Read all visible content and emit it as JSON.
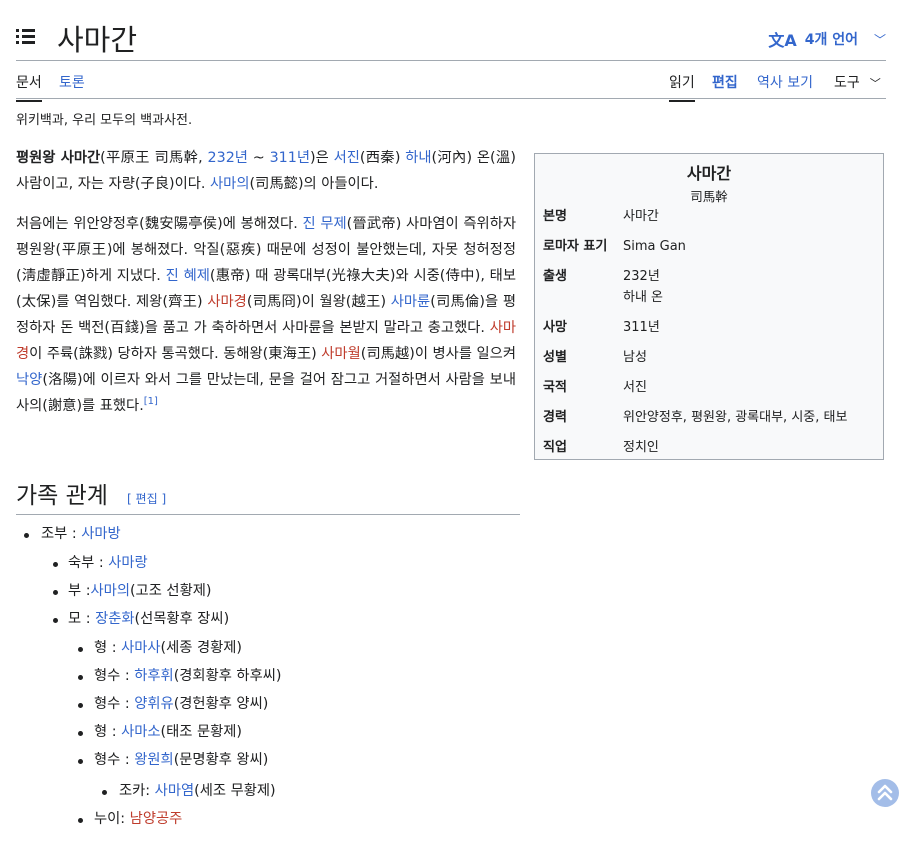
{
  "page": {
    "title": "사마간",
    "lang_button": "4개 언어",
    "tagline": "위키백과, 우리 모두의 백과사전."
  },
  "tabs": {
    "left": [
      "문서",
      "토론"
    ],
    "right": [
      "읽기",
      "편집",
      "역사 보기",
      "도구"
    ]
  },
  "intro": {
    "p1": {
      "bold": "평원왕 사마간",
      "t1": "(平原王 司馬幹, ",
      "born": "232년",
      "t2": " ~ ",
      "died": "311년",
      "t3": ")은 ",
      "dyn": "서진",
      "t4": "(西秦) ",
      "region": "하내",
      "t5": "(河內) 온(溫) 사람이고, 자는 자량(子良)이다. ",
      "father": "사마의",
      "t6": "(司馬懿)의 아들이다."
    },
    "p2": {
      "t1": "처음에는 위안양정후(魏安陽亭侯)에 봉해졌다. ",
      "l1": "진 무제",
      "t2": "(晉武帝) 사마염이 즉위하자 평원왕(平原王)에 봉해졌다. 악질(惡疾) 때문에 성정이 불안했는데, 자못 청허정정(淸虛靜正)하게 지냈다. ",
      "l2": "진 혜제",
      "t3": "(惠帝) 때 광록대부(光祿大夫)와 시중(侍中), 태보(太保)를 역임했다. 제왕(齊王) ",
      "l3": "사마경",
      "t4": "(司馬冏)이 월왕(越王) ",
      "l4": "사마륜",
      "t5": "(司馬倫)을 평정하자 돈 백전(百錢)을 품고 가 축하하면서 사마륜을 본받지 말라고 충고했다. ",
      "l5": "사마경",
      "t6": "이 주륙(誅戮) 당하자 통곡했다. 동해왕(東海王) ",
      "l6": "사마월",
      "t7": "(司馬越)이 병사를 일으켜 ",
      "l7": "낙양",
      "t8": "(洛陽)에 이르자 와서 그를 만났는데, 문을 걸어 잠그고 거절하면서 사람을 보내 사의(謝意)를 표했다.",
      "ref": "[1]"
    }
  },
  "infobox": {
    "title": "사마간",
    "subtitle": "司馬幹",
    "rows": [
      {
        "k": "본명",
        "v": "사마간"
      },
      {
        "k": "로마자 표기",
        "v": "Sima Gan"
      },
      {
        "k": "출생",
        "v": "232년",
        "v2": "하내 온"
      },
      {
        "k": "사망",
        "v": "311년"
      },
      {
        "k": "성별",
        "v": "남성"
      },
      {
        "k": "국적",
        "v": "서진"
      },
      {
        "k": "경력",
        "v": "위안양정후, 평원왕, 광록대부, 시중, 태보"
      },
      {
        "k": "직업",
        "v": "정치인"
      }
    ]
  },
  "family_section": {
    "heading": "가족 관계",
    "edit": "[ 편집 ]"
  },
  "family": [
    {
      "label": "조부 : ",
      "link": "사마방",
      "rest": ""
    },
    {
      "label": "숙부 : ",
      "link": "사마랑",
      "rest": ""
    },
    {
      "label": "부 :",
      "link": "사마의",
      "rest": "(고조 선황제)"
    },
    {
      "label": "모 : ",
      "link": "장춘화",
      "rest": "(선목황후 장씨)"
    },
    {
      "label": "형 : ",
      "link": "사마사",
      "rest": "(세종 경황제)"
    },
    {
      "label": "형수 : ",
      "link": "하후휘",
      "rest": "(경회황후 하후씨)"
    },
    {
      "label": "형수 : ",
      "link": "양휘유",
      "rest": "(경헌황후 양씨)"
    },
    {
      "label": "형 : ",
      "link": "사마소",
      "rest": "(태조 문황제)"
    },
    {
      "label": "형수 : ",
      "link": "왕원희",
      "rest": "(문명황후 왕씨)"
    },
    {
      "label": "조카: ",
      "link": "사마염",
      "rest": "(세조 무황제)"
    },
    {
      "label": "누이: ",
      "link": "남양공주",
      "rest": ""
    }
  ]
}
